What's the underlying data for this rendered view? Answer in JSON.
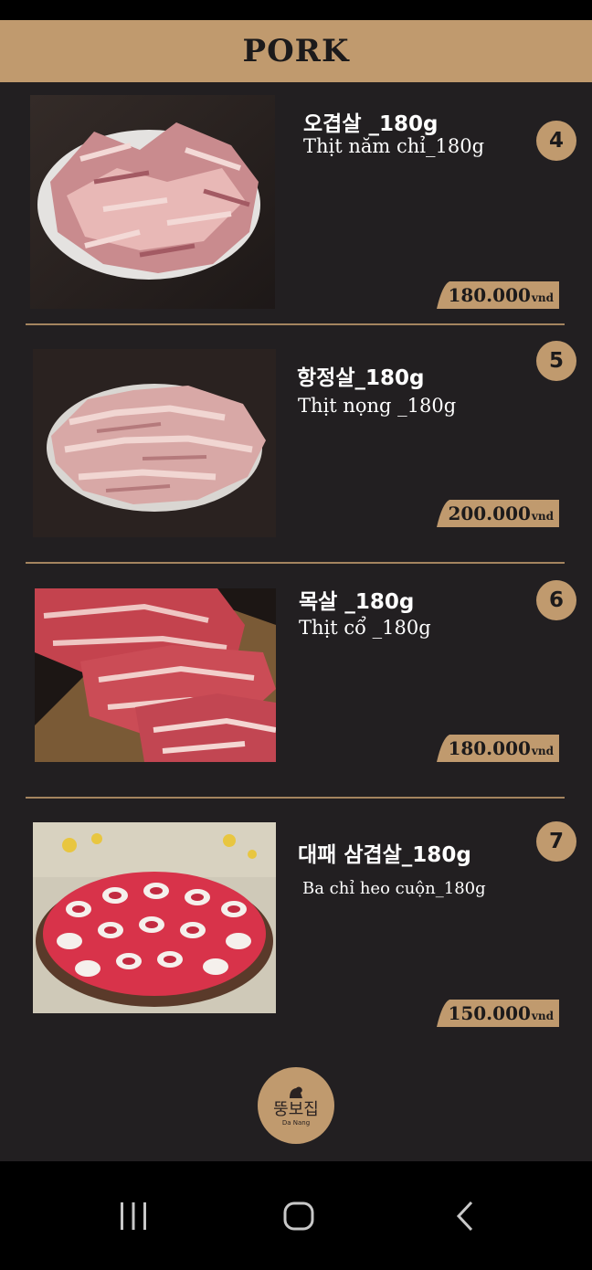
{
  "header": {
    "title": "PORK"
  },
  "items": [
    {
      "name_ko": "오겹살 _180g",
      "name_vi": "Thịt năm chỉ_180g",
      "number": "4",
      "price": "180.000",
      "unit": "vnd",
      "photo": "pork-belly-plate-photo"
    },
    {
      "name_ko": "항정살_180g",
      "name_vi": "Thịt nọng _180g",
      "number": "5",
      "price": "200.000",
      "unit": "vnd",
      "photo": "pork-jowl-plate-photo"
    },
    {
      "name_ko": "목살 _180g",
      "name_vi": "Thịt cổ _180g",
      "number": "6",
      "price": "180.000",
      "unit": "vnd",
      "photo": "pork-neck-slices-photo"
    },
    {
      "name_ko": "대패 삼겹살_180g",
      "name_vi": "Ba chỉ heo cuộn_180g",
      "number": "7",
      "price": "150.000",
      "unit": "vnd",
      "photo": "rolled-pork-belly-photo"
    }
  ],
  "logo": {
    "text": "뚱보집",
    "subtitle": "Da Nang"
  },
  "navigation": {
    "icons": [
      "recent-apps-icon",
      "home-icon",
      "back-icon"
    ]
  },
  "colors": {
    "accent": "#c09a6e",
    "background": "#221f21",
    "text": "#ffffff"
  }
}
